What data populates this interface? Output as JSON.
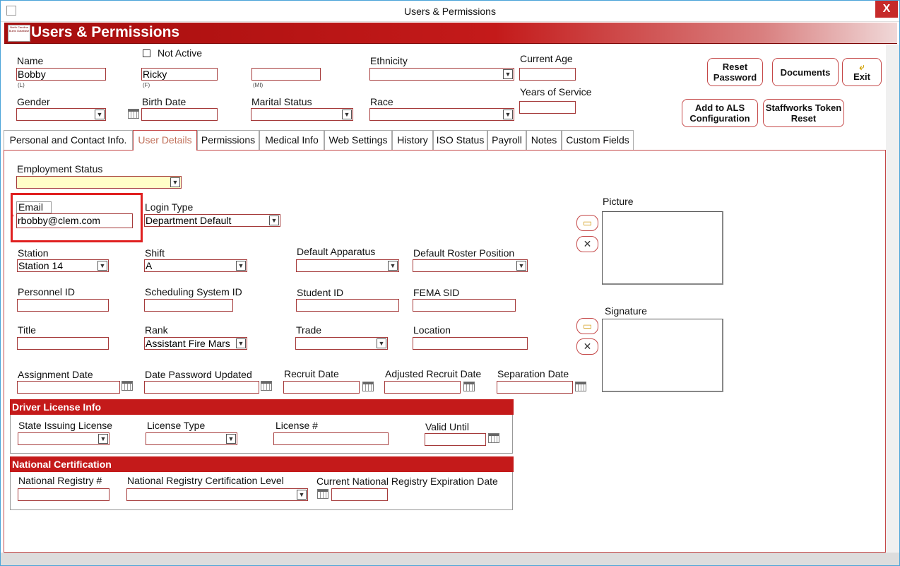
{
  "window": {
    "title": "Users & Permissions",
    "close_glyph": "X"
  },
  "banner": {
    "title": "Users & Permissions",
    "logo_text": "North Carolina Burns Database"
  },
  "header": {
    "name_label": "Name",
    "last": "Bobby",
    "last_sub": "(L)",
    "first": "Ricky",
    "first_sub": "(F)",
    "mi": "",
    "mi_sub": "(MI)",
    "not_active_label": "Not Active",
    "ethnicity_label": "Ethnicity",
    "ethnicity": "",
    "current_age_label": "Current Age",
    "current_age": "",
    "years_label": "Years of Service",
    "years": "",
    "gender_label": "Gender",
    "gender": "",
    "birth_label": "Birth Date",
    "birth": "",
    "marital_label": "Marital Status",
    "marital": "",
    "race_label": "Race",
    "race": ""
  },
  "buttons": {
    "reset_password": "Reset Password",
    "documents": "Documents",
    "exit": "Exit",
    "als": "Add to ALS Configuration",
    "staffworks": "Staffworks Token Reset"
  },
  "tabs": [
    "Personal and Contact Info.",
    "User Details",
    "Permissions",
    "Medical Info",
    "Web Settings",
    "History",
    "ISO Status",
    "Payroll",
    "Notes",
    "Custom Fields"
  ],
  "active_tab": "User Details",
  "details": {
    "employment_status_label": "Employment Status",
    "employment_status": "",
    "email_label": "Email",
    "email": "rbobby@clem.com",
    "login_type_label": "Login Type",
    "login_type": "Department Default",
    "station_label": "Station",
    "station": "Station 14",
    "shift_label": "Shift",
    "shift": "A",
    "default_apparatus_label": "Default Apparatus",
    "default_apparatus": "",
    "default_roster_label": "Default Roster Position",
    "default_roster": "",
    "personnel_id_label": "Personnel ID",
    "personnel_id": "",
    "scheduling_id_label": "Scheduling System ID",
    "scheduling_id": "",
    "student_id_label": "Student ID",
    "student_id": "",
    "fema_sid_label": "FEMA SID",
    "fema_sid": "",
    "title_label": "Title",
    "title": "",
    "rank_label": "Rank",
    "rank": "Assistant Fire Mars",
    "trade_label": "Trade",
    "trade": "",
    "location_label": "Location",
    "location": "",
    "assignment_date_label": "Assignment Date",
    "assignment_date": "",
    "date_pw_label": "Date Password Updated",
    "date_pw": "",
    "recruit_date_label": "Recruit Date",
    "recruit_date": "",
    "adjusted_recruit_label": "Adjusted Recruit Date",
    "adjusted_recruit": "",
    "separation_date_label": "Separation Date",
    "separation_date": "",
    "picture_label": "Picture",
    "signature_label": "Signature"
  },
  "driver": {
    "header": "Driver License Info",
    "state_label": "State Issuing License",
    "state": "",
    "type_label": "License Type",
    "type": "",
    "number_label": "License #",
    "number": "",
    "valid_label": "Valid Until",
    "valid": ""
  },
  "national": {
    "header": "National Certification",
    "registry_label": "National Registry #",
    "registry": "",
    "level_label": "National Registry Certification Level",
    "level": "",
    "expiration_label": "Current National Registry Expiration Date",
    "expiration": ""
  },
  "colors": {
    "brand_red": "#c41a1a",
    "highlight_box": "#e02020",
    "field_border": "#a53a3a"
  }
}
